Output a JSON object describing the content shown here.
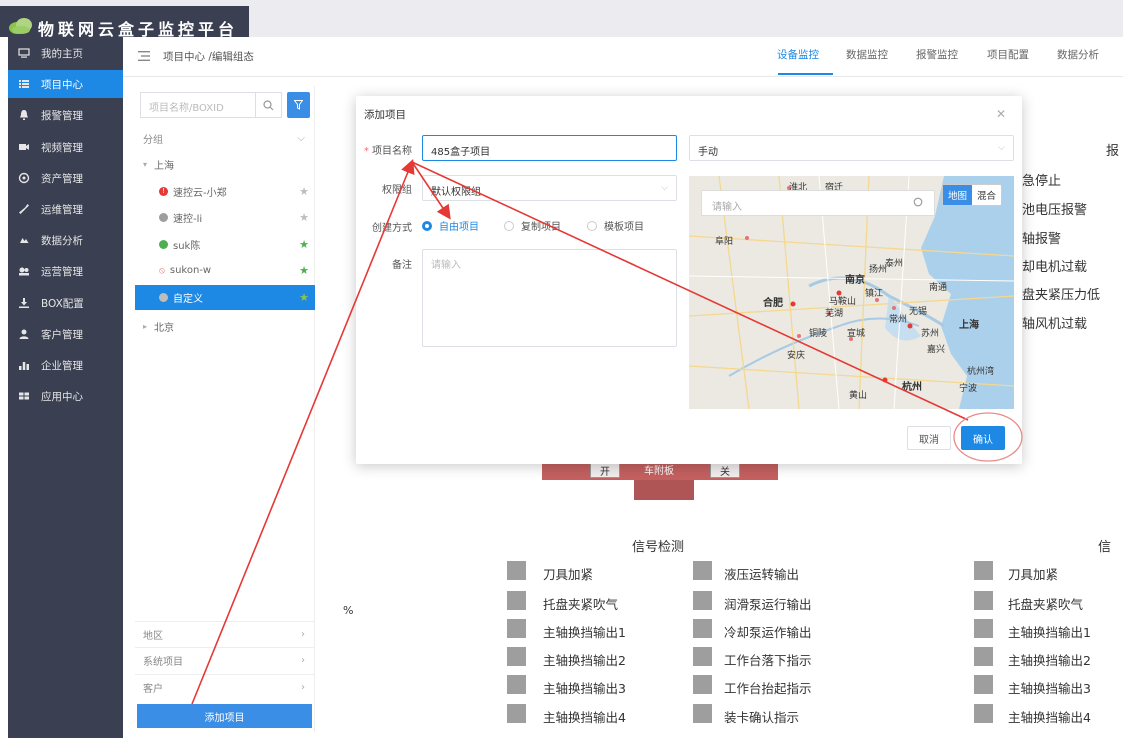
{
  "app": {
    "title": "物联网云盒子监控平台"
  },
  "nav": [
    {
      "label": "我的主页",
      "icon": "monitor-icon"
    },
    {
      "label": "项目中心",
      "icon": "list-icon",
      "active": true
    },
    {
      "label": "报警管理",
      "icon": "bell-icon"
    },
    {
      "label": "视频管理",
      "icon": "video-icon"
    },
    {
      "label": "资产管理",
      "icon": "target-icon"
    },
    {
      "label": "运维管理",
      "icon": "wrench-icon"
    },
    {
      "label": "数据分析",
      "icon": "cloud-icon"
    },
    {
      "label": "运营管理",
      "icon": "users-icon"
    },
    {
      "label": "BOX配置",
      "icon": "download-icon"
    },
    {
      "label": "客户管理",
      "icon": "user-group-icon"
    },
    {
      "label": "企业管理",
      "icon": "org-icon"
    },
    {
      "label": "应用中心",
      "icon": "grid-icon"
    }
  ],
  "header": {
    "breadcrumb": "项目中心 /编辑组态",
    "tabs": [
      "设备监控",
      "数据监控",
      "报警监控",
      "项目配置",
      "数据分析"
    ],
    "active_tab": 0
  },
  "tree": {
    "search_placeholder": "项目名称/BOXID",
    "group_label": "分组",
    "groups": [
      {
        "name": "上海",
        "expanded": true
      },
      {
        "name": "北京",
        "expanded": false
      }
    ],
    "items": [
      {
        "name": "速控云-小郑",
        "status": "error",
        "color": "#e53935",
        "star_color": "#bdbdbd"
      },
      {
        "name": "速控-li",
        "status": "offline",
        "color": "#9e9e9e",
        "star_color": "#bdbdbd"
      },
      {
        "name": "suk陈",
        "status": "online",
        "color": "#4caf50",
        "star_color": "#4caf50"
      },
      {
        "name": "sukon-w",
        "status": "link",
        "color": "#e57373",
        "star_color": "#4caf50"
      },
      {
        "name": "自定义",
        "status": "offline",
        "color": "#bdbdbd",
        "star_color": "#8bc34a",
        "selected": true
      }
    ],
    "sections": [
      "地区",
      "系统项目",
      "客户"
    ],
    "add_button": "添加项目"
  },
  "background": {
    "signal_title": "信号检测",
    "signal_title_right": "信",
    "percent": "%",
    "alarm_title": "报",
    "alarm_items": [
      "急停止",
      "池电压报警",
      "轴报警",
      "却电机过载",
      "盘夹紧压力低",
      "轴风机过载"
    ],
    "col1": [
      "刀具加紧",
      "托盘夹紧吹气",
      "主轴换挡输出1",
      "主轴换挡输出2",
      "主轴换挡输出3",
      "主轴换挡输出4"
    ],
    "col2": [
      "液压运转输出",
      "润滑泵运行输出",
      "冷却泵运作输出",
      "工作台落下指示",
      "工作台抬起指示",
      "装卡确认指示"
    ],
    "col3": [
      "刀具加紧",
      "托盘夹紧吹气",
      "主轴换挡输出1",
      "主轴换挡输出2",
      "主轴换挡输出3",
      "主轴换挡输出4"
    ],
    "machine_labels": [
      "开",
      "车附板",
      "关"
    ]
  },
  "modal": {
    "title": "添加项目",
    "name_label": "项目名称",
    "name_value": "485盒子项目",
    "mode_value": "手动",
    "perm_label": "权限组",
    "perm_value": "默认权限组",
    "create_label": "创建方式",
    "create_options": [
      "自由项目",
      "复制项目",
      "模板项目"
    ],
    "create_selected": 0,
    "note_label": "备注",
    "note_placeholder": "请输入",
    "map_search_placeholder": "请输入",
    "map_modes": [
      "地图",
      "混合"
    ],
    "map_cities": [
      "南京",
      "合肥",
      "上海",
      "杭州",
      "马鞍山",
      "芜湖",
      "无锡",
      "苏州",
      "常州",
      "嘉兴",
      "阜阳",
      "安庆",
      "黄山",
      "宣城",
      "铜陵",
      "宁波",
      "泰州",
      "南通",
      "扬州",
      "淮北",
      "宿迁",
      "镇江",
      "杭州湾"
    ],
    "cancel": "取消",
    "confirm": "确认"
  },
  "colors": {
    "accent": "#1e88e5",
    "nav_bg": "#3a3f51",
    "annotation": "#e53935"
  }
}
